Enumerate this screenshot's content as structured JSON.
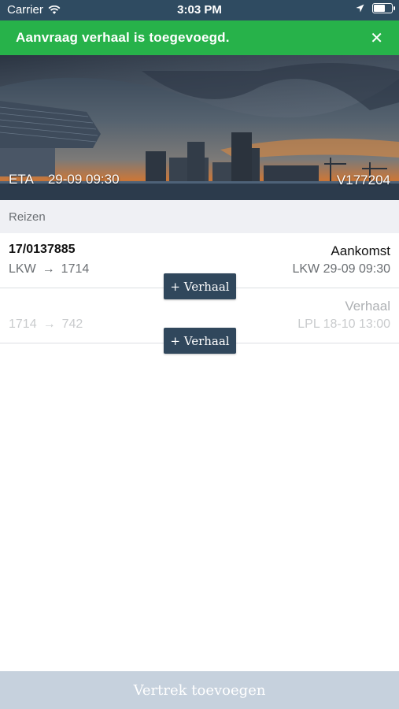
{
  "status_bar": {
    "carrier": "Carrier",
    "time": "3:03 PM",
    "battery_level": 0.6
  },
  "toast": {
    "message": "Aanvraag verhaal is toegevoegd.",
    "close_glyph": "✕"
  },
  "header": {
    "eta_label": "ETA",
    "eta_value": "29-09 09:30",
    "vessel_code": "V177204"
  },
  "section": {
    "title": "Reizen"
  },
  "trips": [
    {
      "id": "17/0137885",
      "from": "LKW",
      "arrow": "→",
      "to": "1714",
      "kind": "Aankomst",
      "dest": "LKW 29-09 09:30"
    },
    {
      "id": "",
      "from": "1714",
      "arrow": "→",
      "to": "742",
      "kind": "Verhaal",
      "dest": "LPL 18-10 13:00"
    }
  ],
  "buttons": {
    "add_verhaal_1": "+ Verhaal",
    "add_verhaal_2": "+ Verhaal"
  },
  "footer": {
    "add_departure": "Vertrek toevoegen"
  },
  "colors": {
    "toast": "#27b24a",
    "navbar": "#2f4b61",
    "button": "#30475c",
    "footer": "#c6d1dd"
  }
}
